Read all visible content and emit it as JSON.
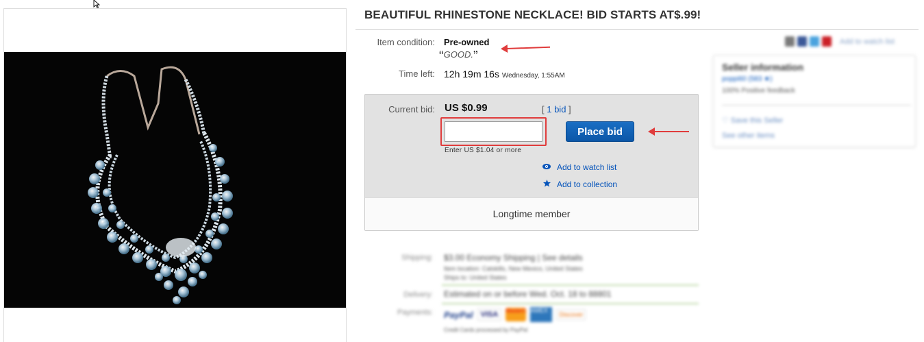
{
  "product": {
    "title": "BEAUTIFUL RHINESTONE NECKLACE! BID STARTS AT$.99!"
  },
  "condition": {
    "label": "Item condition:",
    "value": "Pre-owned",
    "note": "GOOD.",
    "quote_open": "“",
    "quote_close": "”"
  },
  "time_left": {
    "label": "Time left:",
    "value": "12h 19m 16s",
    "end": "Wednesday, 1:55AM"
  },
  "bid": {
    "label": "Current bid:",
    "price": "US $0.99",
    "count_open": "[ ",
    "count_link": "1 bid",
    "count_close": " ]",
    "input_value": "",
    "button": "Place bid",
    "hint": "Enter US $1.04 or more",
    "watch": "Add to watch list",
    "collection": "Add to collection",
    "footer": "Longtime member"
  },
  "share": {
    "watch_link": "Add to watch list",
    "colors": [
      "#7a7a7a",
      "#3b5998",
      "#4aa3df",
      "#cb2027"
    ]
  },
  "seller": {
    "heading": "Seller information",
    "username": "poppi60 (583 ★)",
    "feedback": "100% Positive feedback",
    "save": "Save this Seller",
    "other": "See other items"
  },
  "shipping": {
    "shipping_label": "Shipping:",
    "shipping_value": "$3.00 Economy Shipping | See details",
    "location": "Item location: Catskills, New Mexico, United States",
    "ships_to": "Ships to: United States",
    "delivery_label": "Delivery:",
    "delivery_value": "Estimated on or before Wed. Oct. 18 to 88801",
    "payments_label": "Payments:",
    "payments_note": "Credit Cards processed by PayPal",
    "payment_methods": [
      "PayPal",
      "VISA",
      "MasterCard",
      "AMEX",
      "Discover"
    ]
  },
  "icons": {
    "cursor": "pointer-cursor-icon",
    "watch": "eye-icon",
    "collection": "star-icon"
  }
}
